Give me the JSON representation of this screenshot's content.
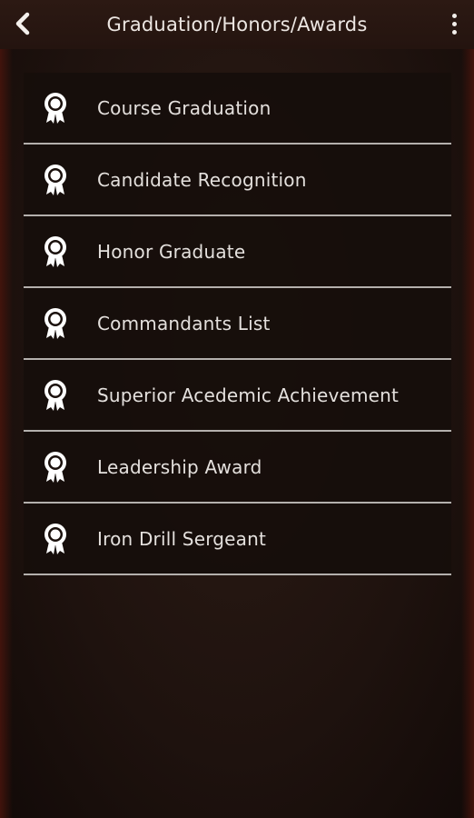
{
  "header": {
    "title": "Graduation/Honors/Awards",
    "back_icon": "chevron-left-icon",
    "menu_icon": "more-vertical-icon"
  },
  "awards": {
    "icon": "award-ribbon-icon",
    "items": [
      {
        "label": "Course Graduation"
      },
      {
        "label": "Candidate Recognition"
      },
      {
        "label": "Honor Graduate"
      },
      {
        "label": "Commandants List"
      },
      {
        "label": "Superior Acedemic Achievement"
      },
      {
        "label": "Leadership Award"
      },
      {
        "label": "Iron Drill Sergeant"
      }
    ]
  },
  "colors": {
    "background": "#2a1812",
    "text": "#e4e0dd",
    "divider": "#b4b0ad"
  }
}
